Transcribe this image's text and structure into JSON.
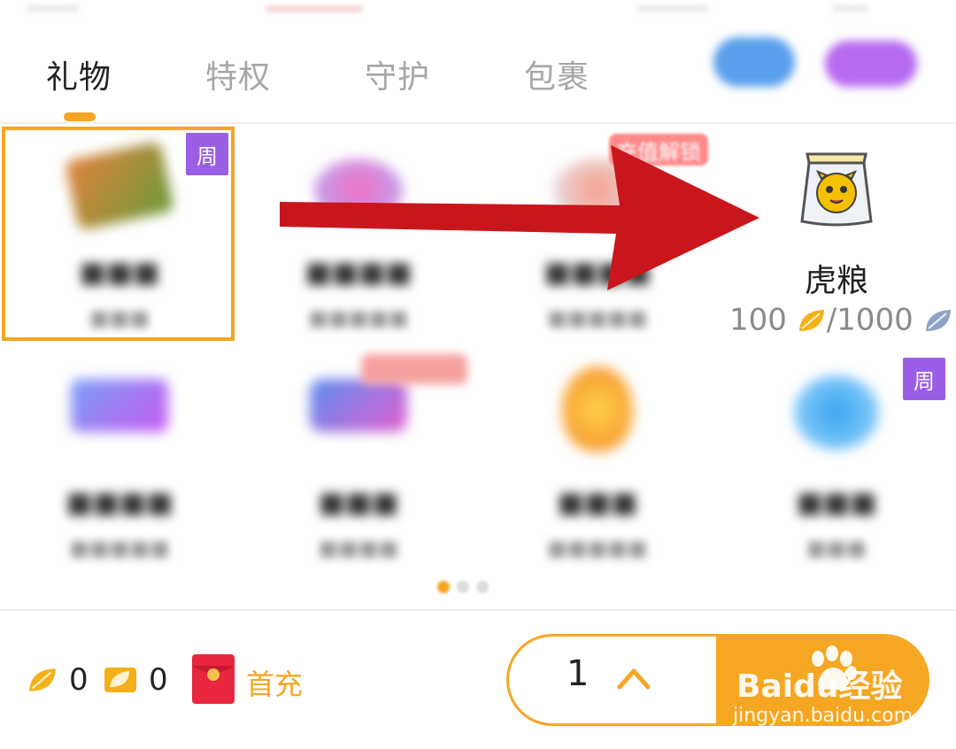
{
  "tabs": [
    "礼物",
    "特权",
    "守护",
    "包裹"
  ],
  "featured_gift": {
    "name": "虎粮",
    "price": "100",
    "limit": "/1000"
  },
  "unlock_badge": "充值解锁",
  "week_badge": "周",
  "bottom": {
    "leaf_balance": "0",
    "ticket_balance": "0",
    "first_charge": "首充",
    "quantity": "1"
  },
  "watermark": {
    "brand": "Baidu经验",
    "url": "jingyan.baidu.com"
  },
  "colors": {
    "accent": "#f5a623",
    "week_badge": "#9a5ee6",
    "arrow": "#c9161c"
  }
}
